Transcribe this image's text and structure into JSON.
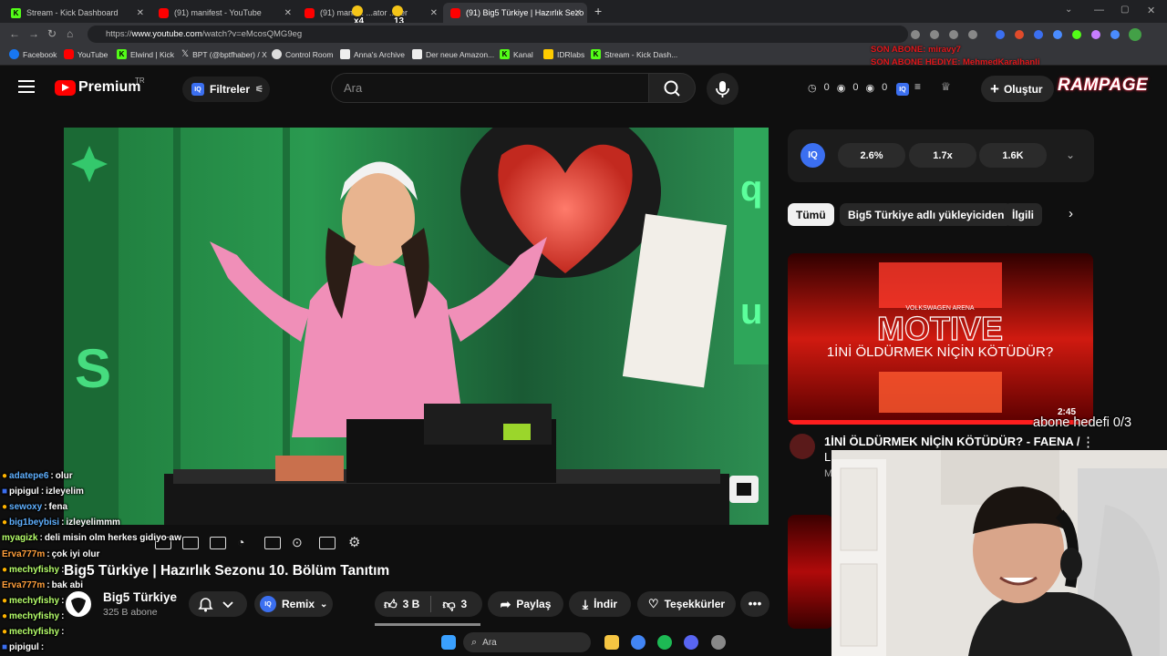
{
  "browser": {
    "tabs": [
      {
        "title": "Stream - Kick Dashboard",
        "favicon": "kick-favicon",
        "active": false
      },
      {
        "title": "(91) manifest - YouTube",
        "favicon": "youtube-favicon",
        "active": false
      },
      {
        "title": "(91) manif... ...ator ...ser",
        "favicon": "youtube-favicon",
        "active": false
      },
      {
        "title": "(91) Big5 Türkiye | Hazırlık Sezo",
        "favicon": "youtube-favicon",
        "active": true
      }
    ],
    "url_prefix": "https://",
    "url_domain": "www.youtube.com",
    "url_path": "/watch?v=eMcosQMG9eg",
    "bookmarks": [
      {
        "label": "Facebook",
        "icon": "facebook-icon"
      },
      {
        "label": "YouTube",
        "icon": "youtube-icon"
      },
      {
        "label": "Elwind | Kick",
        "icon": "kick-icon"
      },
      {
        "label": "BPT (@bptfhaber) / X",
        "icon": "x-icon"
      },
      {
        "label": "Control Room",
        "icon": "gear-icon"
      },
      {
        "label": "Anna's Archive",
        "icon": "archive-icon"
      },
      {
        "label": "Der neue Amazon...",
        "icon": "amazon-icon"
      },
      {
        "label": "Kanal",
        "icon": "kick-icon"
      },
      {
        "label": "IDRlabs",
        "icon": "idrlabs-icon"
      },
      {
        "label": "Stream - Kick Dash...",
        "icon": "kick-icon"
      }
    ],
    "tab_overlay_counts": [
      "x4",
      "13"
    ]
  },
  "overlay": {
    "abone_line1": "SON ABONE: miravy7",
    "abone_line2": "SON ABONE HEDIYE: MehmedKaralhanli",
    "brand": "RAMPAGE",
    "abone_goal": "abone hedefi 0/3"
  },
  "youtube": {
    "logo_text": "Premium",
    "region": "TR",
    "filters_label": "Filtreler",
    "search_placeholder": "Ara",
    "counters": [
      "0",
      "0",
      "0"
    ],
    "create_label": "Oluştur",
    "video": {
      "title": "Big5 Türkiye | Hazırlık Sezonu 10. Bölüm Tanıtım",
      "channel": "Big5 Türkiye",
      "subscribers": "325 B abone",
      "remix_label": "Remix",
      "likes": "3 B",
      "dislikes": "3",
      "share_label": "Paylaş",
      "download_label": "İndir",
      "thanks_label": "Teşekkürler"
    },
    "iq_stats": [
      "2.6%",
      "1.7x",
      "1.6K"
    ],
    "chips": [
      {
        "label": "Tümü",
        "selected": true
      },
      {
        "label": "Big5 Türkiye adlı yükleyiciden",
        "selected": false
      },
      {
        "label": "İlgili",
        "selected": false
      }
    ],
    "recommendation": {
      "thumb_venue": "VOLKSWAGEN ARENA",
      "thumb_brand": "MOTIVE",
      "thumb_caption": "1İNİ ÖLDÜRMEK NİÇİN KÖTÜDÜR?",
      "duration": "2:45",
      "title": "1İNİ ÖLDÜRMEK NİÇİN KÖTÜDÜR? - FAENA /",
      "title_line2": "L",
      "channel_initial": "M"
    }
  },
  "chat": [
    {
      "user": "adatepe6",
      "message": "olur",
      "color": "#5fb0ff"
    },
    {
      "user": "pipigul",
      "message": "izleyelim",
      "color": "#ffffff"
    },
    {
      "user": "sewoxy",
      "message": "fena",
      "color": "#5fb0ff"
    },
    {
      "user": "big1beybisi",
      "message": "izleyelimmm",
      "color": "#5fb0ff"
    },
    {
      "user": "myagizk",
      "message": "deli misin olm herkes gidiyo aw",
      "color": "#b6ff6b"
    },
    {
      "user": "Erva777m",
      "message": "çok iyi olur",
      "color": "#ff9f3c"
    },
    {
      "user": "mechyfishy",
      "message": "",
      "color": "#b6ff6b"
    },
    {
      "user": "Erva777m",
      "message": "bak abi",
      "color": "#ff9f3c"
    },
    {
      "user": "mechyfishy",
      "message": "",
      "color": "#b6ff6b"
    },
    {
      "user": "mechyfishy",
      "message": "",
      "color": "#b6ff6b"
    },
    {
      "user": "mechyfishy",
      "message": "",
      "color": "#b6ff6b"
    },
    {
      "user": "pipigul",
      "message": "",
      "color": "#ffffff"
    }
  ],
  "taskbar": {
    "search_placeholder": "Ara"
  },
  "colors": {
    "youtube_red": "#ff0000",
    "kick_green": "#53fc18",
    "iq_blue": "#3b6ff0",
    "overlay_red": "#e0181c"
  }
}
